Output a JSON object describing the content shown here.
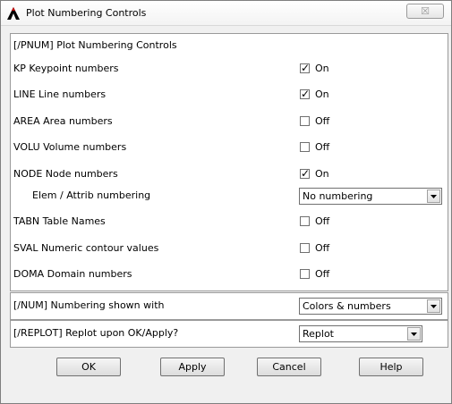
{
  "window": {
    "title": "Plot Numbering Controls",
    "close_glyph": "☒",
    "icon": "ansys-logo-icon"
  },
  "panel": {
    "header": "[/PNUM]  Plot Numbering Controls",
    "rows": [
      {
        "label": "KP   Keypoint numbers",
        "checked": true,
        "state": "On"
      },
      {
        "label": "LINE  Line numbers",
        "checked": true,
        "state": "On"
      },
      {
        "label": "AREA  Area numbers",
        "checked": false,
        "state": "Off"
      },
      {
        "label": "VOLU  Volume numbers",
        "checked": false,
        "state": "Off"
      },
      {
        "label": "NODE  Node numbers",
        "checked": true,
        "state": "On"
      },
      {
        "label": "TABN  Table Names",
        "checked": false,
        "state": "Off"
      },
      {
        "label": "SVAL  Numeric contour values",
        "checked": false,
        "state": "Off"
      },
      {
        "label": "DOMA  Domain numbers",
        "checked": false,
        "state": "Off"
      }
    ],
    "elem": {
      "label": "Elem / Attrib numbering",
      "value": "No numbering"
    }
  },
  "num": {
    "label": "[/NUM]  Numbering shown with",
    "value": "Colors & numbers"
  },
  "replot": {
    "label": "[/REPLOT]  Replot upon OK/Apply?",
    "value": "Replot"
  },
  "buttons": {
    "ok": "OK",
    "apply": "Apply",
    "cancel": "Cancel",
    "help": "Help"
  },
  "colors": {
    "dialog_bg": "#f0f0f0",
    "panel_bg": "#ffffff",
    "border": "#9a9a9a"
  }
}
